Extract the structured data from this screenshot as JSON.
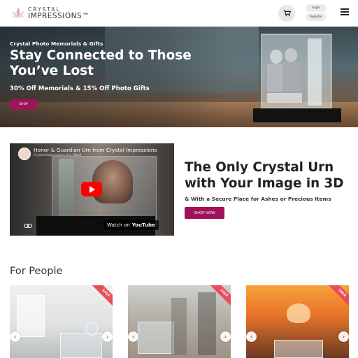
{
  "header": {
    "logo_top": "CRYSTAL",
    "logo_bottom": "IMPRESSIONS™",
    "login_label": "Login",
    "register_label": "Register",
    "icons": {
      "cart": "cart-icon",
      "menu": "menu-icon"
    }
  },
  "hero": {
    "kicker": "Crystal Photo Memorials & Gifts",
    "title": "Stay Connected to Those You’ve Lost",
    "offer": "30% Off Memorials & 15% Off Photo Gifts",
    "shop_label": "SHOP"
  },
  "video": {
    "title": "Honor & Guardian Urn from Crystal Impressions",
    "channel": "Crystal Impressions Inc. Ward",
    "watch_on": "Watch on",
    "watch_brand": "YouTube"
  },
  "urn": {
    "title": "The Only Crystal Urn with Your Image in 3D",
    "subtitle": "& With a Secure Place for Ashes or Precious Items",
    "shop_label": "SHOP NOW"
  },
  "people": {
    "title": "For People",
    "cards": [
      {
        "ribbon": "SALE"
      },
      {
        "ribbon": "SALE"
      },
      {
        "ribbon": "SALE"
      }
    ]
  },
  "colors": {
    "accent": "#a0125a",
    "sale_ribbon": "#e64f5a",
    "youtube_red": "#ff0000"
  }
}
